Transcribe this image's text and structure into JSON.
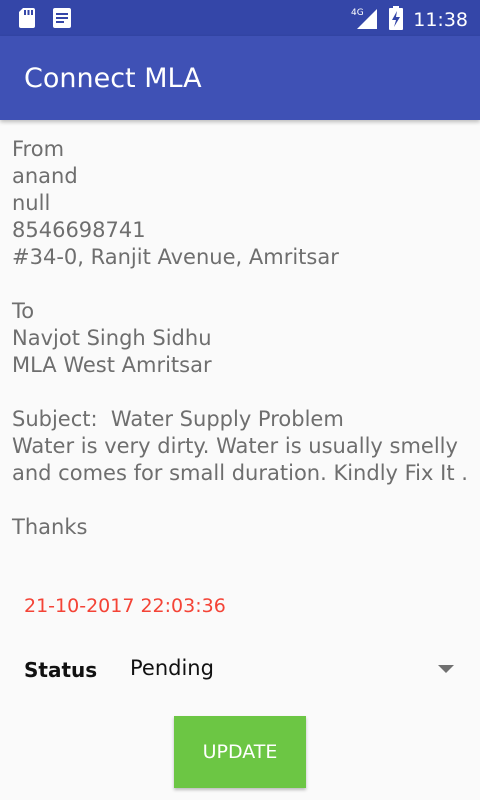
{
  "status_bar": {
    "time": "11:38",
    "network_label": "4G",
    "icons": [
      "sd-card-icon",
      "notification-icon",
      "signal-icon",
      "battery-icon"
    ]
  },
  "app_bar": {
    "title": "Connect MLA"
  },
  "letter": {
    "from_label": "From",
    "sender_name": "anand",
    "sender_extra": "null",
    "sender_phone": "8546698741",
    "sender_address": "#34-0, Ranjit Avenue, Amritsar",
    "to_label": "To",
    "recipient_name": "Navjot Singh Sidhu",
    "recipient_title": "MLA West Amritsar",
    "subject_line": "Subject:  Water Supply Problem",
    "body_line1": "Water is very dirty. Water is usually smelly",
    "body_line2": "and comes for small duration. Kindly Fix It .",
    "closing": "Thanks"
  },
  "timestamp": "21-10-2017 22:03:36",
  "status": {
    "label": "Status",
    "selected": "Pending"
  },
  "update_button": {
    "label": "UPDATE"
  },
  "colors": {
    "status_bar": "#3446a8",
    "app_bar": "#3f51b5",
    "timestamp": "#f44336",
    "button": "#6cc644",
    "body_text": "#6e6e6e"
  }
}
